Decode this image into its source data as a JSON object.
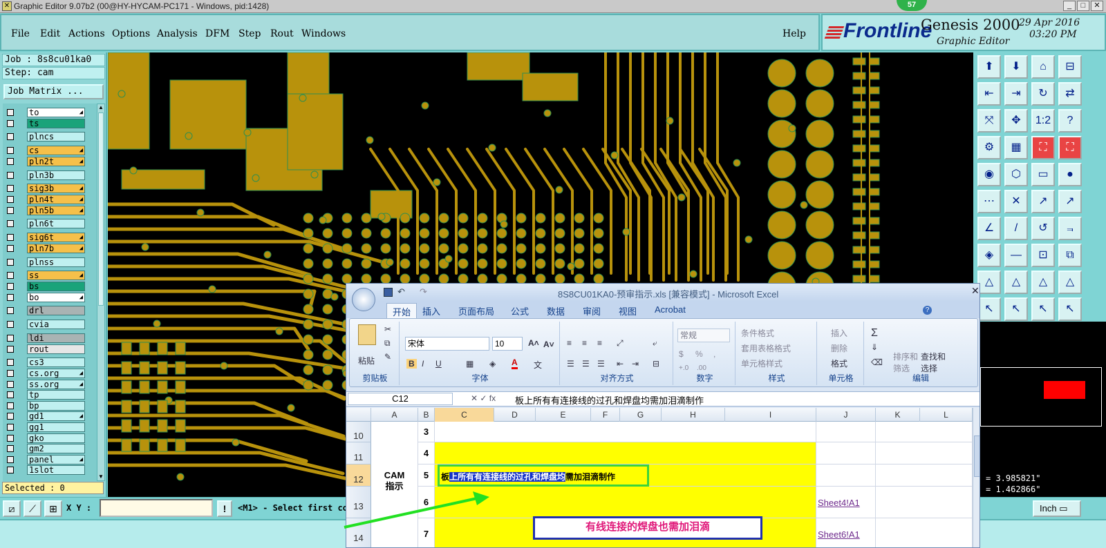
{
  "window": {
    "title": "Graphic Editor 9.07b2 (00@HY-HYCAM-PC171 - Windows, pid:1428)",
    "badge": "57"
  },
  "menu": [
    "File",
    "Edit",
    "Actions",
    "Options",
    "Analysis",
    "DFM",
    "Step",
    "Rout",
    "Windows"
  ],
  "help_label": "Help",
  "brand": {
    "logo": "Frontline",
    "product": "Genesis 2000",
    "subtitle": "Graphic Editor",
    "date": "29 Apr 2016",
    "time": "03:20 PM"
  },
  "job": {
    "job_label": "Job : 8s8cu01ka0",
    "step_label": "Step: cam",
    "matrix_button": "Job Matrix ..."
  },
  "layers": [
    {
      "name": "to",
      "color": "#ffffff",
      "arrow": true
    },
    {
      "name": "ts",
      "color": "#1aa37a",
      "arrow": false
    },
    {
      "name": "plncs",
      "color": "#bff0f0",
      "arrow": false
    },
    {
      "name": "cs",
      "color": "#f6c04a",
      "arrow": true
    },
    {
      "name": "pln2t",
      "color": "#f6c04a",
      "arrow": true
    },
    {
      "name": "pln3b",
      "color": "#bff0f0",
      "arrow": false
    },
    {
      "name": "sig3b",
      "color": "#f6c04a",
      "arrow": true
    },
    {
      "name": "pln4t",
      "color": "#f6c04a",
      "arrow": true
    },
    {
      "name": "pln5b",
      "color": "#f6c04a",
      "arrow": true
    },
    {
      "name": "pln6t",
      "color": "#bff0f0",
      "arrow": false
    },
    {
      "name": "sig6t",
      "color": "#f6c04a",
      "arrow": true
    },
    {
      "name": "pln7b",
      "color": "#f6c04a",
      "arrow": true
    },
    {
      "name": "plnss",
      "color": "#bff0f0",
      "arrow": false
    },
    {
      "name": "ss",
      "color": "#f6c04a",
      "arrow": true
    },
    {
      "name": "bs",
      "color": "#1aa37a",
      "arrow": false
    },
    {
      "name": "bo",
      "color": "#ffffff",
      "arrow": true
    },
    {
      "name": "drl",
      "color": "#a9b3b3",
      "arrow": false
    },
    {
      "name": "cvia",
      "color": "#bff0f0",
      "arrow": false
    },
    {
      "name": "ldi",
      "color": "#a9b3b3",
      "arrow": false
    },
    {
      "name": "rout",
      "color": "#e6e6e6",
      "arrow": false
    },
    {
      "name": "cs3",
      "color": "#bff0f0",
      "arrow": false
    },
    {
      "name": "cs.org",
      "color": "#bff0f0",
      "arrow": true
    },
    {
      "name": "ss.org",
      "color": "#bff0f0",
      "arrow": true
    },
    {
      "name": "tp",
      "color": "#bff0f0",
      "arrow": false
    },
    {
      "name": "bp",
      "color": "#bff0f0",
      "arrow": false
    },
    {
      "name": "gd1",
      "color": "#bff0f0",
      "arrow": true
    },
    {
      "name": "gg1",
      "color": "#bff0f0",
      "arrow": false
    },
    {
      "name": "gko",
      "color": "#bff0f0",
      "arrow": false
    },
    {
      "name": "gm2",
      "color": "#bff0f0",
      "arrow": false
    },
    {
      "name": "panel",
      "color": "#bff0f0",
      "arrow": true
    },
    {
      "name": "1slot",
      "color": "#bff0f0",
      "arrow": false
    }
  ],
  "selected": "Selected : 0",
  "xy_label": "X Y :",
  "prompt": "<M1> - Select first co",
  "units": "Inch",
  "coords": {
    "x": "= 3.985821\"",
    "y": "= 1.462866\""
  },
  "excel": {
    "title": "8S8CU01KA0-预审指示.xls  [兼容模式] - Microsoft Excel",
    "tabs": [
      "开始",
      "插入",
      "页面布局",
      "公式",
      "数据",
      "审阅",
      "视图",
      "Acrobat"
    ],
    "groups": [
      "剪贴板",
      "字体",
      "对齐方式",
      "数字",
      "样式",
      "单元格",
      "编辑"
    ],
    "paste": "粘贴",
    "font": "宋体",
    "size": "10",
    "number_format": "常规",
    "styles": [
      "条件格式",
      "套用表格格式",
      "单元格样式"
    ],
    "cells_cmds": [
      "插入",
      "删除",
      "格式"
    ],
    "edit_cmds": [
      "排序和筛选",
      "查找和选择"
    ],
    "namebox": "C12",
    "formula": "板上所有有连接线的过孔和焊盘均需加泪滴制作",
    "cols": [
      "A",
      "B",
      "C",
      "D",
      "E",
      "F",
      "G",
      "H",
      "I",
      "J",
      "K",
      "L"
    ],
    "rows": [
      {
        "n": "10",
        "b": "3",
        "yel": false
      },
      {
        "n": "11",
        "b": "4",
        "yel": true
      },
      {
        "n": "12",
        "b": "5",
        "yel": true
      },
      {
        "n": "13",
        "b": "6",
        "yel": true
      },
      {
        "n": "14",
        "b": "7",
        "yel": true
      }
    ],
    "merged_a": "CAM\n指示",
    "cell_c12_pre": "板",
    "cell_c12_sel": "上所有有连接线的过孔和焊盘均",
    "cell_c12_post": "需加泪滴制作",
    "link13": "Sheet4!A1",
    "link14": "Sheet6!A1",
    "callout": "有线连接的焊盘也需加泪滴"
  }
}
